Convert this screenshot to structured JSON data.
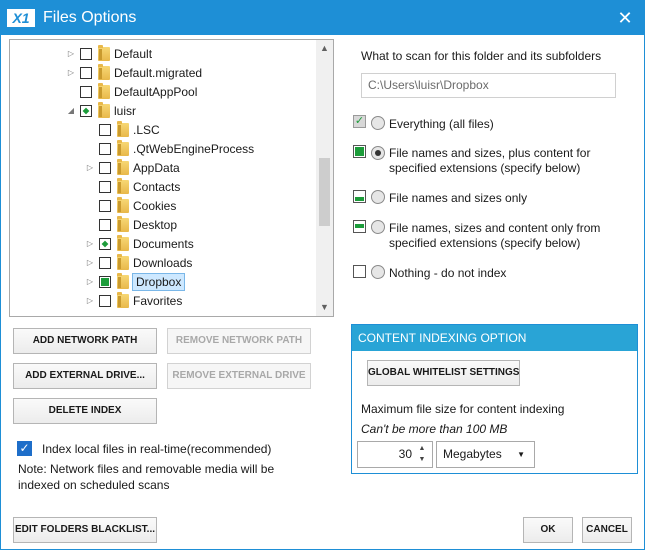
{
  "window": {
    "logo_text": "X1",
    "title": "Files Options",
    "close_glyph": "✕"
  },
  "tree": {
    "items": [
      {
        "label": "Default",
        "has_expander": true,
        "check": "empty",
        "selected": false
      },
      {
        "label": "Default.migrated",
        "has_expander": true,
        "check": "empty",
        "selected": false
      },
      {
        "label": "DefaultAppPool",
        "has_expander": false,
        "check": "empty",
        "selected": false
      },
      {
        "label": "luisr",
        "has_expander": true,
        "expanded": true,
        "check": "partial",
        "selected": false
      },
      {
        "label": ".LSC",
        "has_expander": false,
        "check": "empty",
        "selected": false
      },
      {
        "label": ".QtWebEngineProcess",
        "has_expander": false,
        "check": "empty",
        "selected": false
      },
      {
        "label": "AppData",
        "has_expander": true,
        "check": "empty",
        "selected": false
      },
      {
        "label": "Contacts",
        "has_expander": false,
        "check": "empty",
        "selected": false
      },
      {
        "label": "Cookies",
        "has_expander": false,
        "check": "empty",
        "selected": false
      },
      {
        "label": "Desktop",
        "has_expander": false,
        "check": "empty",
        "selected": false
      },
      {
        "label": "Documents",
        "has_expander": true,
        "check": "partial",
        "selected": false
      },
      {
        "label": "Downloads",
        "has_expander": true,
        "check": "empty",
        "selected": false
      },
      {
        "label": "Dropbox",
        "has_expander": true,
        "check": "full",
        "selected": true
      },
      {
        "label": "Favorites",
        "has_expander": true,
        "check": "empty",
        "selected": false
      }
    ]
  },
  "buttons": {
    "add_network_path": "ADD NETWORK PATH",
    "remove_network_path": "REMOVE NETWORK PATH",
    "add_external_drive": "ADD EXTERNAL DRIVE...",
    "remove_external_drive": "REMOVE EXTERNAL DRIVE",
    "delete_index": "DELETE INDEX",
    "edit_blacklist": "EDIT FOLDERS BLACKLIST...",
    "ok": "OK",
    "cancel": "CANCEL",
    "global_whitelist": "GLOBAL WHITELIST SETTINGS"
  },
  "realtime": {
    "checked": true,
    "label": "Index local files in real-time(recommended)",
    "note": "Note: Network files and removable media will be indexed on scheduled scans"
  },
  "scan": {
    "heading": "What to scan for this folder and its subfolders",
    "path": "C:\\Users\\luisr\\Dropbox",
    "options": [
      {
        "label": "Everything (all files)",
        "selected": false
      },
      {
        "label": "File names and sizes, plus content for specified extensions (specify below)",
        "selected": true
      },
      {
        "label": "File names and sizes only",
        "selected": false
      },
      {
        "label": "File names, sizes and content only from specified extensions (specify below)",
        "selected": false
      },
      {
        "label": "Nothing - do not index",
        "selected": false
      }
    ]
  },
  "content_indexing": {
    "header": "CONTENT INDEXING OPTION",
    "max_size_label": "Maximum file size for content indexing",
    "max_size_hint": "Can't be more than 100 MB",
    "max_size_value": "30",
    "unit": "Megabytes"
  },
  "colors": {
    "accent": "#1e8fd6",
    "panel_header": "#29a4d6",
    "index_green": "#1c9c3a"
  }
}
